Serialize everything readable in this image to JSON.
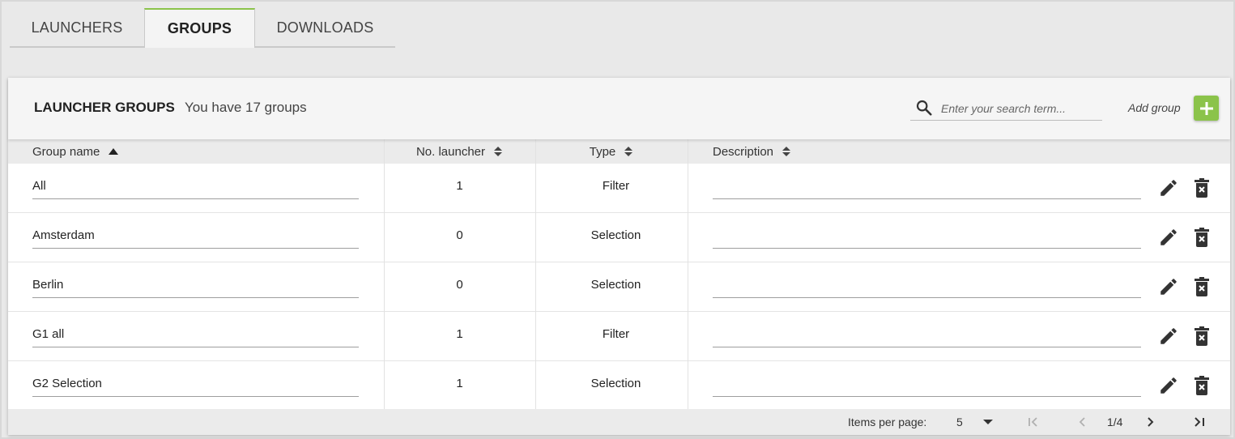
{
  "tabs": [
    {
      "label": "LAUNCHERS",
      "active": false
    },
    {
      "label": "GROUPS",
      "active": true
    },
    {
      "label": "DOWNLOADS",
      "active": false
    }
  ],
  "header": {
    "title": "LAUNCHER GROUPS",
    "count_text": "You have 17 groups",
    "search_placeholder": "Enter your search term...",
    "add_label": "Add group"
  },
  "table": {
    "columns": [
      {
        "label": "Group name",
        "sort": "ascending"
      },
      {
        "label": "No. launcher",
        "sort": "none"
      },
      {
        "label": "Type",
        "sort": "none"
      },
      {
        "label": "Description",
        "sort": "none"
      }
    ],
    "rows": [
      {
        "name": "All",
        "count": "1",
        "type": "Filter",
        "description": ""
      },
      {
        "name": "Amsterdam",
        "count": "0",
        "type": "Selection",
        "description": ""
      },
      {
        "name": "Berlin",
        "count": "0",
        "type": "Selection",
        "description": ""
      },
      {
        "name": "G1 all",
        "count": "1",
        "type": "Filter",
        "description": ""
      },
      {
        "name": "G2 Selection",
        "count": "1",
        "type": "Selection",
        "description": ""
      }
    ]
  },
  "pagination": {
    "items_per_page_label": "Items per page:",
    "items_per_page_value": "5",
    "page_text": "1/4"
  },
  "colors": {
    "accent": "#8bc34a",
    "icon": "#333333",
    "disabled_icon": "#b0b0b0"
  },
  "icons": {
    "search": "search-icon",
    "add": "plus-icon",
    "edit": "pencil-icon",
    "delete": "trash-x-icon",
    "sort_asc": "sort-asc-icon",
    "sort_both": "sort-both-icon",
    "dropdown": "caret-down-icon",
    "first": "first-page-icon",
    "prev": "chevron-left-icon",
    "next": "chevron-right-icon",
    "last": "last-page-icon"
  }
}
